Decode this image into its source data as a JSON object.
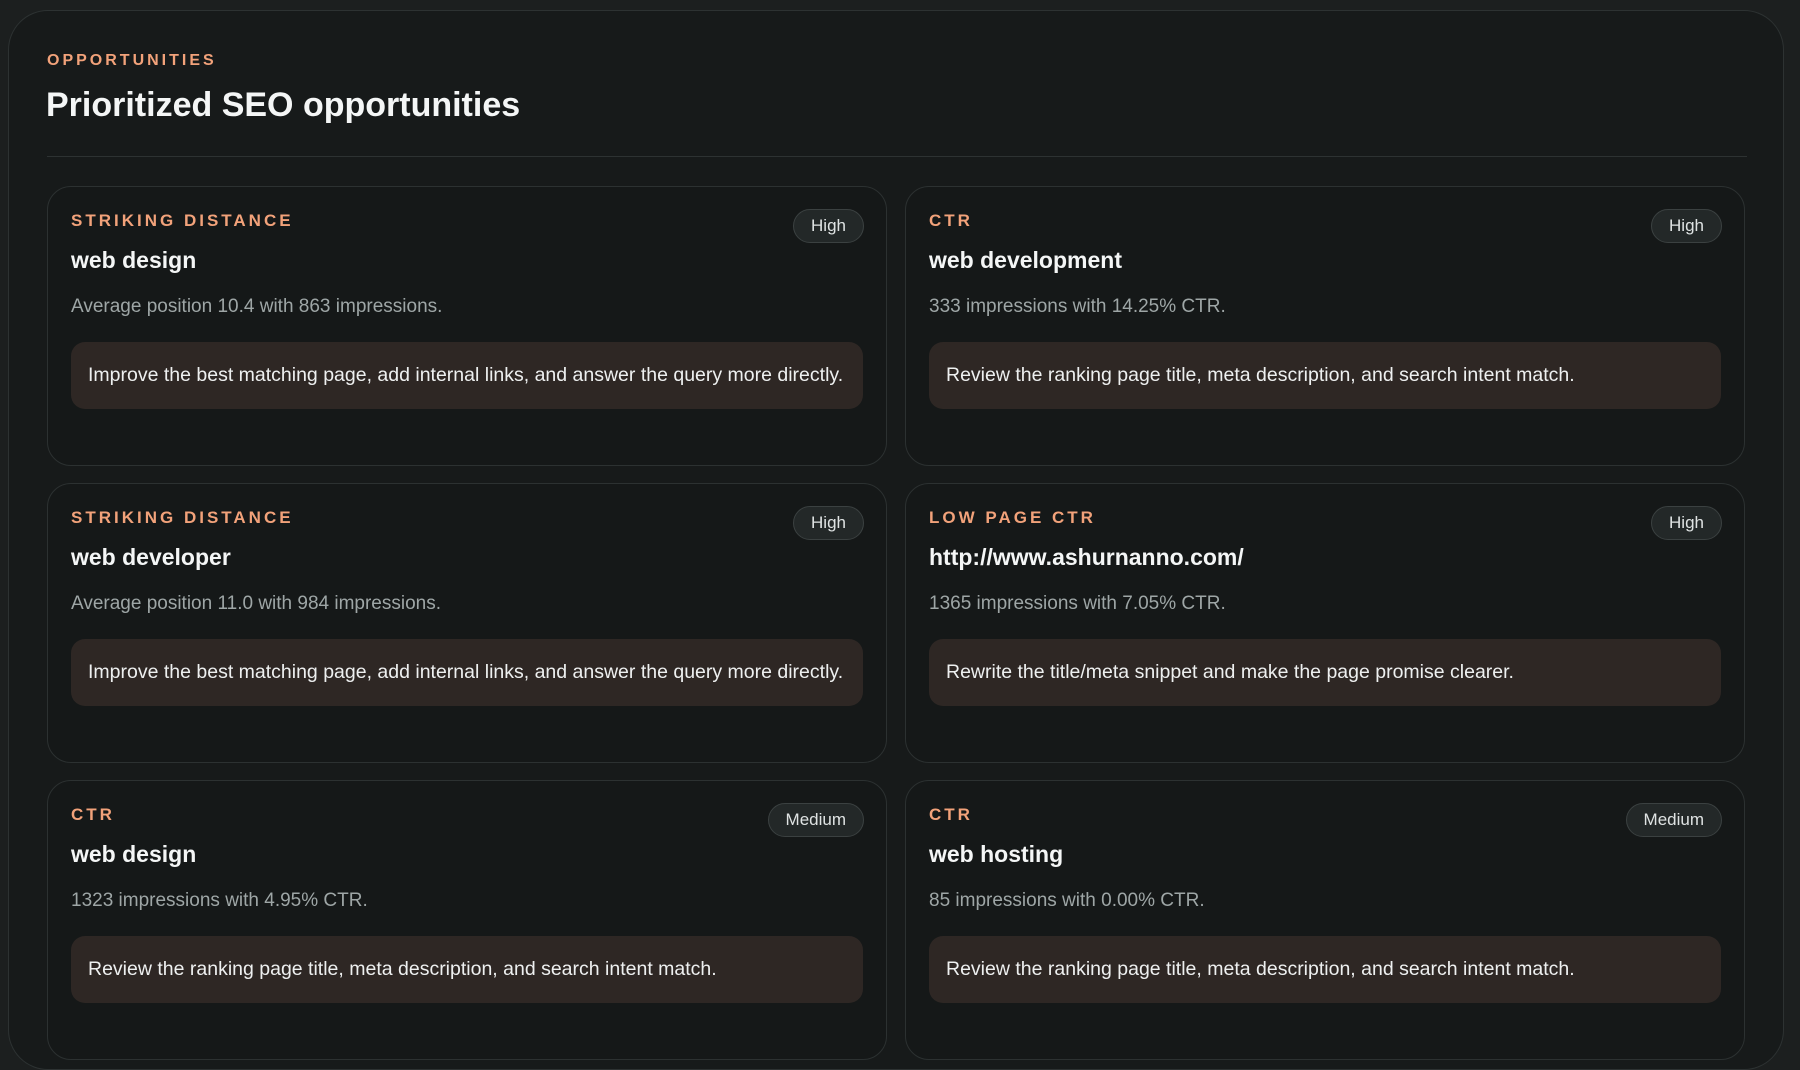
{
  "section": {
    "eyebrow": "OPPORTUNITIES",
    "title": "Prioritized SEO opportunities"
  },
  "colors": {
    "accent": "#f2a27a",
    "background": "#171a1a",
    "action_box": "#2e2724"
  },
  "opportunities": [
    {
      "type": "STRIKING DISTANCE",
      "priority": "High",
      "keyword": "web design",
      "metric": "Average position 10.4 with 863 impressions.",
      "action": "Improve the best matching page, add internal links, and answer the query more directly."
    },
    {
      "type": "CTR",
      "priority": "High",
      "keyword": "web development",
      "metric": "333 impressions with 14.25% CTR.",
      "action": "Review the ranking page title, meta description, and search intent match."
    },
    {
      "type": "STRIKING DISTANCE",
      "priority": "High",
      "keyword": "web developer",
      "metric": "Average position 11.0 with 984 impressions.",
      "action": "Improve the best matching page, add internal links, and answer the query more directly."
    },
    {
      "type": "LOW PAGE CTR",
      "priority": "High",
      "keyword": "http://www.ashurnanno.com/",
      "metric": "1365 impressions with 7.05% CTR.",
      "action": "Rewrite the title/meta snippet and make the page promise clearer."
    },
    {
      "type": "CTR",
      "priority": "Medium",
      "keyword": "web design",
      "metric": "1323 impressions with 4.95% CTR.",
      "action": "Review the ranking page title, meta description, and search intent match."
    },
    {
      "type": "CTR",
      "priority": "Medium",
      "keyword": "web hosting",
      "metric": "85 impressions with 0.00% CTR.",
      "action": "Review the ranking page title, meta description, and search intent match."
    }
  ]
}
